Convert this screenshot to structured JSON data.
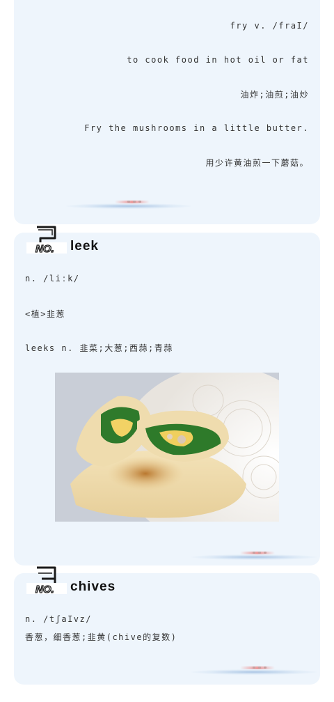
{
  "section_fry": {
    "headword": "fry v. /fraI/",
    "definition": "to cook food in hot oil or fat",
    "translation": "油炸;油煎;油炒",
    "example_en": "Fry the mushrooms in a little butter.",
    "example_zh": "用少许黄油煎一下蘑菇。"
  },
  "section_leek": {
    "badge_number": "2",
    "badge_label": "NO.",
    "title": "leek",
    "phonetic": "n. /liːk/",
    "category": "<植>韭葱",
    "plural": "leeks n. 韭菜;大葱;西蒜;青蒜"
  },
  "section_chives": {
    "badge_number": "3",
    "badge_label": "NO.",
    "title": "chives",
    "phonetic": "n. /tʃaIvz/",
    "definition_zh": "香葱，细香葱;韭黄(chive的复数)"
  },
  "colors": {
    "card_bg": "#eef5fc",
    "badge_ink": "#1a1a1a"
  }
}
